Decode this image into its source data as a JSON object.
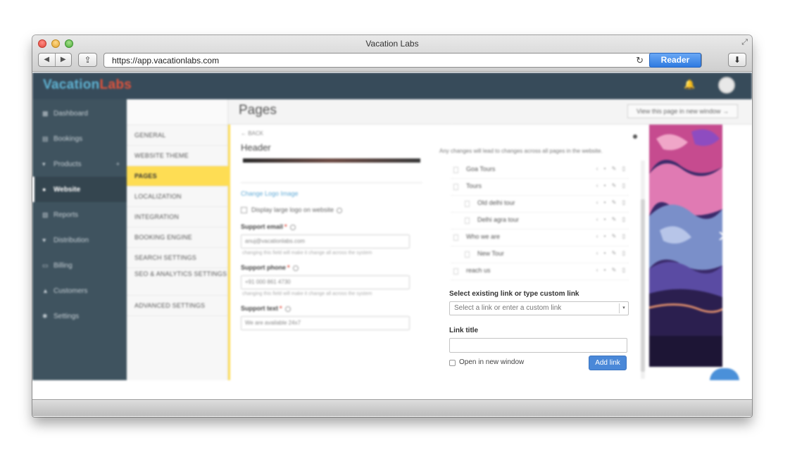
{
  "browser": {
    "title": "Vacation Labs",
    "url": "https://app.vacationlabs.com",
    "reader_label": "Reader",
    "back_glyph": "◀",
    "forward_glyph": "▶",
    "share_glyph": "⇪",
    "reload_glyph": "↻",
    "download_glyph": "⬇",
    "fullscreen_glyph": "⤢"
  },
  "app": {
    "logo_part1": "Vacation",
    "logo_part2": "Labs",
    "brand_color": "#5fb3d3",
    "accent_color": "#e2533b",
    "bell_glyph": "🔔"
  },
  "sidebar": {
    "items": [
      {
        "label": "Dashboard",
        "icon": "▦"
      },
      {
        "label": "Bookings",
        "icon": "▤"
      },
      {
        "label": "Products",
        "icon": "▾",
        "extra": "+"
      },
      {
        "label": "Website",
        "icon": "●"
      },
      {
        "label": "Reports",
        "icon": "▧"
      },
      {
        "label": "Distribution",
        "icon": "♥"
      },
      {
        "label": "Billing",
        "icon": "▭"
      },
      {
        "label": "Customers",
        "icon": "▲"
      },
      {
        "label": "Settings",
        "icon": "✱"
      }
    ]
  },
  "subnav": {
    "items": [
      {
        "label": "GENERAL"
      },
      {
        "label": "WEBSITE THEME"
      },
      {
        "label": "PAGES"
      },
      {
        "label": "LOCALIZATION"
      },
      {
        "label": "INTEGRATION"
      },
      {
        "label": "BOOKING ENGINE"
      },
      {
        "label": "SEARCH SETTINGS"
      },
      {
        "label": "SEO & ANALYTICS SETTINGS"
      },
      {
        "label": "ADVANCED SETTINGS"
      }
    ]
  },
  "main": {
    "page_title": "Pages",
    "view_button": "View this page in new window →",
    "back_label": "← BACK",
    "section_title": "Header",
    "notice": "Any changes will lead to changes across all pages in the website."
  },
  "editor": {
    "change_logo": "Change Logo Image",
    "large_logo_label": "Display large logo on website",
    "support_email_label": "Support email",
    "support_email_value": "anuj@vacationlabs.com",
    "support_email_help": "changing this field will make it change all across the system",
    "support_phone_label": "Support phone",
    "support_phone_value": "+91 000 861 4730",
    "support_phone_help": "changing this field will make it change all across the system",
    "support_text_label": "Support text",
    "support_text_value": "We are available 24x7",
    "required_mark": "*"
  },
  "menu": {
    "items": [
      {
        "label": "Goa Tours"
      },
      {
        "label": "Tours"
      },
      {
        "label": "Old delhi tour"
      },
      {
        "label": "Delhi agra tour"
      },
      {
        "label": "Who we are"
      },
      {
        "label": "New Tour"
      },
      {
        "label": "reach us"
      }
    ],
    "actions": "‹ • ✎ ▯"
  },
  "link_form": {
    "select_label": "Select existing link or type custom link",
    "select_placeholder": "Select a link or enter a custom link",
    "caret": "▾",
    "title_label": "Link title",
    "title_value": "",
    "new_window_label": "Open in new window",
    "add_button": "Add link"
  },
  "preview": {
    "chevron": "›"
  }
}
